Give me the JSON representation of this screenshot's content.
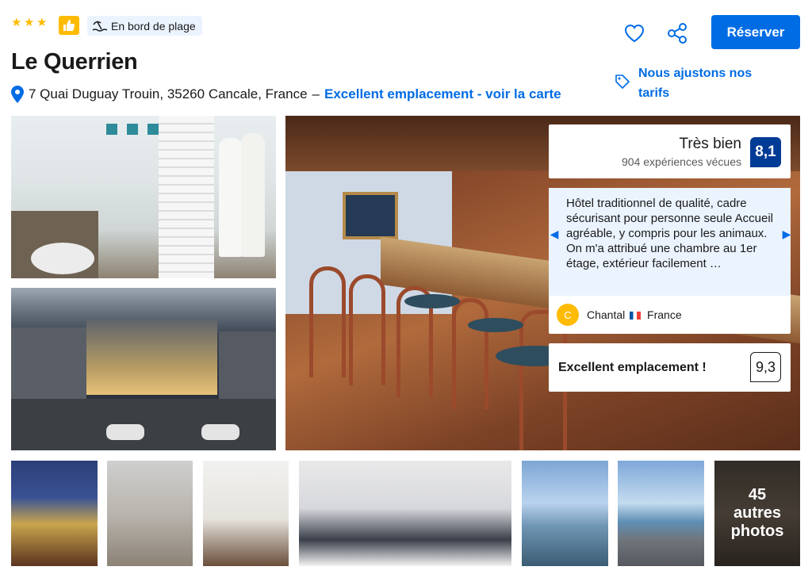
{
  "header": {
    "stars": 3,
    "beach_badge": "En bord de plage",
    "hotel_name": "Le Querrien",
    "address": "7 Quai Duguay Trouin, 35260 Cancale, France",
    "address_separator": "–",
    "map_link": "Excellent emplacement - voir la carte",
    "reserve_label": "Réserver",
    "price_match": "Nous ajustons nos tarifs"
  },
  "review": {
    "rating_label": "Très bien",
    "experience_count": "904 expériences vécues",
    "score": "8,1",
    "quote": "Hôtel traditionnel de qualité, cadre sécurisant pour personne seule Accueil agréable, y compris pour les animaux. On m'a attribué une chambre au 1er étage, extérieur facilement …",
    "author_initial": "C",
    "author_name": "Chantal",
    "author_country": "France"
  },
  "location": {
    "label": "Excellent emplacement !",
    "score": "9,3"
  },
  "gallery": {
    "more_count": "45",
    "more_label": "autres photos"
  },
  "colors": {
    "accent_blue": "#006ce4",
    "score_badge": "#003b95",
    "star_yellow": "#febb02",
    "review_bg": "#ebf3ff"
  },
  "icons": [
    "star-icon",
    "thumbs-up-icon",
    "beach-icon",
    "location-pin-icon",
    "heart-icon",
    "share-icon",
    "price-tag-icon",
    "chevron-left-icon",
    "chevron-right-icon"
  ]
}
